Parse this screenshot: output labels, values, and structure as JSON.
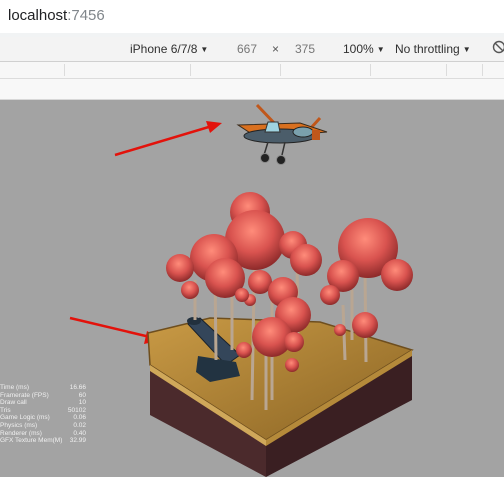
{
  "browser": {
    "url_host": "localhost",
    "url_port": ":7456"
  },
  "device_toolbar": {
    "device": "iPhone 6/7/8",
    "width": "667",
    "height": "375",
    "zoom": "100%",
    "throttling": "No throttling"
  },
  "stats": [
    {
      "label": "Time (ms)",
      "value": "16.66"
    },
    {
      "label": "Framerate (FPS)",
      "value": "60"
    },
    {
      "label": "Draw call",
      "value": "10"
    },
    {
      "label": "Tris",
      "value": "50102"
    },
    {
      "label": "Game Logic (ms)",
      "value": "0.06"
    },
    {
      "label": "Physics (ms)",
      "value": "0.02"
    },
    {
      "label": "Renderer (ms)",
      "value": "0.40"
    },
    {
      "label": "GFX Texture Mem(M)",
      "value": "32.99"
    }
  ]
}
